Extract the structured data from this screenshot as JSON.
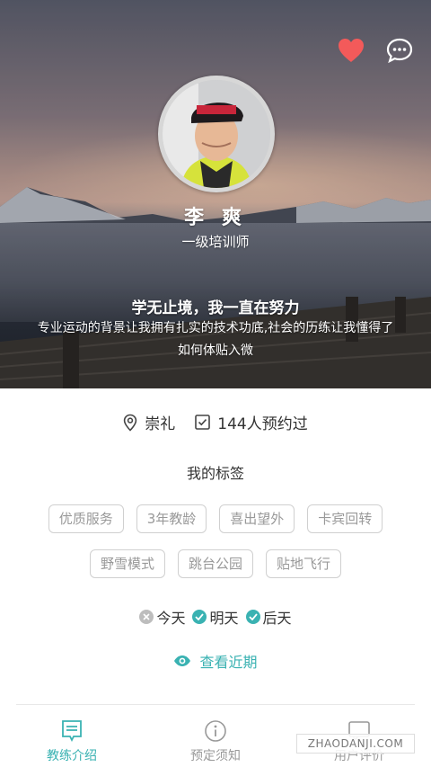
{
  "header": {
    "favorite_icon": "heart-icon",
    "message_icon": "chat-bubble-icon",
    "accent_heart": "#f35a5a"
  },
  "coach": {
    "name": "李 爽",
    "rank": "一级培训师",
    "motto": "学无止境，我一直在努力",
    "description": "专业运动的背景让我拥有扎实的技术功底,社会的历练让我懂得了如何体贴入微"
  },
  "meta": {
    "location": "崇礼",
    "bookings": "144人预约过"
  },
  "tags": {
    "title": "我的标签",
    "row1": [
      "优质服务",
      "3年教龄",
      "喜出望外",
      "卡宾回转"
    ],
    "row2": [
      "野雪模式",
      "跳台公园",
      "贴地飞行"
    ]
  },
  "availability": [
    {
      "label": "今天",
      "available": false
    },
    {
      "label": "明天",
      "available": true
    },
    {
      "label": "后天",
      "available": true
    }
  ],
  "recent_button": "查看近期",
  "tabs": [
    {
      "label": "教练介绍",
      "icon": "coach-intro-icon",
      "active": true
    },
    {
      "label": "预定须知",
      "icon": "info-icon",
      "active": false
    },
    {
      "label": "用户评价",
      "icon": "review-icon",
      "active": false
    }
  ],
  "watermark": "ZHAODANJI.COM",
  "colors": {
    "accent": "#3ab2b2",
    "tag_border": "#d0d0d0",
    "inactive": "#bdbdbd"
  }
}
